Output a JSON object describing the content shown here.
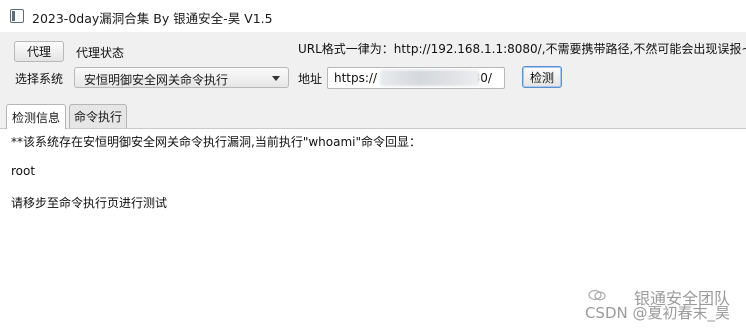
{
  "window": {
    "title": "2023-0day漏洞合集 By 银通安全-昊 V1.5"
  },
  "toolbar": {
    "proxy_button": "代理",
    "proxy_status_label": "代理状态",
    "url_hint": "URL格式一律为：http://192.168.1.1:8080/,不需要携带路径,不然可能会出现误报~",
    "select_system_label": "选择系统",
    "selected_system": "安恒明御安全网关命令执行",
    "address_label": "地址",
    "address_value": "https://                    :4430/",
    "detect_button": "检测"
  },
  "tabs": [
    {
      "label": "检测信息",
      "active": true
    },
    {
      "label": "命令执行",
      "active": false
    }
  ],
  "output": {
    "line1": "**该系统存在安恒明御安全网关命令执行漏洞,当前执行\"whoami\"命令回显：",
    "line2": "root",
    "line3": "请移步至命令执行页进行测试"
  },
  "watermark": {
    "line1": "银通安全团队",
    "line2": "CSDN @夏初春末_昊"
  },
  "icons": {
    "app": "app-window-icon",
    "dropdown": "chevron-down-icon",
    "wechat": "wechat-icon"
  }
}
